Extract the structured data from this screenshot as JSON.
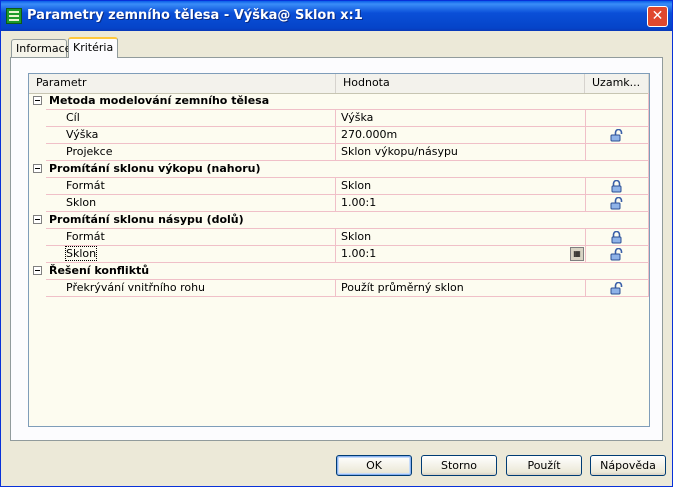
{
  "window": {
    "title": "Parametry zemního tělesa - Výška@ Sklon x:1",
    "close_label": "✕"
  },
  "tabs": [
    {
      "label": "Informace"
    },
    {
      "label": "Kritéria"
    }
  ],
  "grid": {
    "columns": {
      "param": "Parametr",
      "value": "Hodnota",
      "lock": "Uzamk..."
    },
    "rows": [
      {
        "kind": "group",
        "label": "Metoda modelování zemního tělesa"
      },
      {
        "kind": "prop",
        "label": "Cíl",
        "value": "Výška",
        "lock": ""
      },
      {
        "kind": "prop",
        "label": "Výška",
        "value": "270.000m",
        "lock": "unlocked"
      },
      {
        "kind": "prop",
        "label": "Projekce",
        "value": "Sklon výkopu/násypu",
        "lock": ""
      },
      {
        "kind": "group",
        "label": "Promítání sklonu výkopu (nahoru)"
      },
      {
        "kind": "prop",
        "label": "Formát",
        "value": "Sklon",
        "lock": "locked"
      },
      {
        "kind": "prop",
        "label": "Sklon",
        "value": "1.00:1",
        "lock": "unlocked"
      },
      {
        "kind": "group",
        "label": "Promítání sklonu násypu (dolů)"
      },
      {
        "kind": "prop",
        "label": "Formát",
        "value": "Sklon",
        "lock": "locked"
      },
      {
        "kind": "prop",
        "label": "Sklon",
        "value": "1.00:1",
        "lock": "unlocked",
        "selected": true
      },
      {
        "kind": "group",
        "label": "Řešení konfliktů"
      },
      {
        "kind": "prop",
        "label": "Překrývání vnitřního rohu",
        "value": "Použít průměrný sklon",
        "lock": "unlocked"
      }
    ]
  },
  "buttons": {
    "ok": "OK",
    "cancel": "Storno",
    "apply": "Použít",
    "help": "Nápověda"
  }
}
